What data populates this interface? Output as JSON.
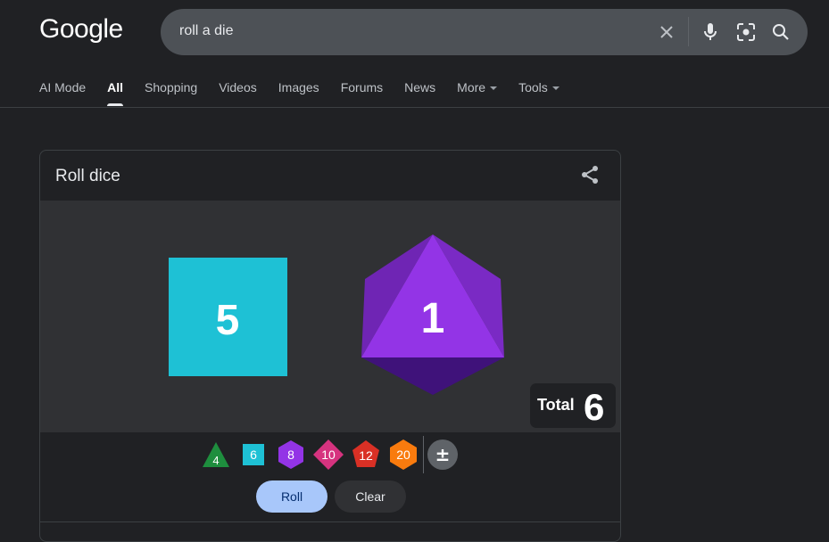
{
  "header": {
    "logo": "Google"
  },
  "search": {
    "query": "roll a die"
  },
  "tabs": [
    {
      "label": "AI Mode"
    },
    {
      "label": "All"
    },
    {
      "label": "Shopping"
    },
    {
      "label": "Videos"
    },
    {
      "label": "Images"
    },
    {
      "label": "Forums"
    },
    {
      "label": "News"
    },
    {
      "label": "More"
    },
    {
      "label": "Tools"
    }
  ],
  "card": {
    "title": "Roll dice",
    "dice": [
      {
        "type": "d6",
        "value": "5",
        "color": "#1ec1d5"
      },
      {
        "type": "d8",
        "value": "1",
        "color": "#9334e6"
      }
    ],
    "total_label": "Total",
    "total_value": "6",
    "picker": [
      {
        "label": "4",
        "color": "#1e8e3e"
      },
      {
        "label": "6",
        "color": "#1ec1d5"
      },
      {
        "label": "8",
        "color": "#9334e6"
      },
      {
        "label": "10",
        "color": "#d6337f"
      },
      {
        "label": "12",
        "color": "#d93025"
      },
      {
        "label": "20",
        "color": "#f97b0e"
      },
      {
        "label": "±",
        "color": "#5f6368"
      }
    ],
    "roll_label": "Roll",
    "clear_label": "Clear"
  },
  "icons": [
    "clear-icon",
    "mic-icon",
    "lens-icon",
    "search-icon",
    "share-icon"
  ]
}
